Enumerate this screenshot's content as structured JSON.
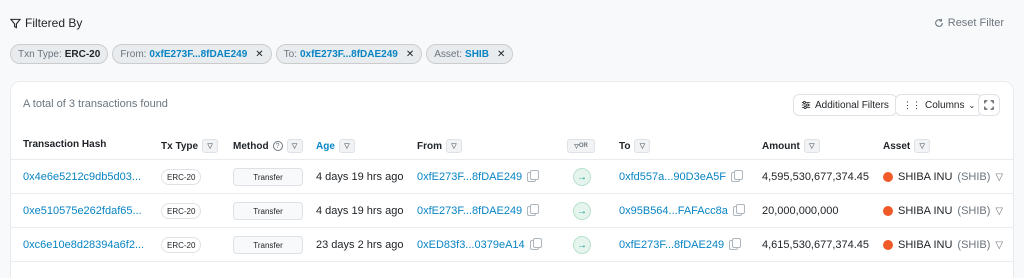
{
  "filter_bar": {
    "title": "Filtered By",
    "reset_label": "Reset Filter"
  },
  "chips": [
    {
      "label": "Txn Type:",
      "value": "ERC-20",
      "link": false,
      "closable": false
    },
    {
      "label": "From:",
      "value": "0xfE273F...8fDAE249",
      "link": true,
      "closable": true
    },
    {
      "label": "To:",
      "value": "0xfE273F...8fDAE249",
      "link": true,
      "closable": true
    },
    {
      "label": "Asset:",
      "value": "SHIB",
      "link": true,
      "closable": true
    }
  ],
  "card": {
    "summary": "A total of 3 transactions found",
    "additional_filters_label": "Additional Filters",
    "columns_label": "Columns"
  },
  "headers": {
    "hash": "Transaction Hash",
    "txtype": "Tx Type",
    "method": "Method",
    "age": "Age",
    "from": "From",
    "or": "OR",
    "to": "To",
    "amount": "Amount",
    "asset": "Asset"
  },
  "rows": [
    {
      "hash": "0x4e6e5212c9db5d03...",
      "txtype": "ERC-20",
      "method": "Transfer",
      "age": "4 days 19 hrs ago",
      "from": "0xfE273F...8fDAE249",
      "to": "0xfd557a...90D3eA5F",
      "amount": "4,595,530,677,374.45",
      "asset_name": "SHIBA INU",
      "asset_symbol": "(SHIB)"
    },
    {
      "hash": "0xe510575e262fdaf65...",
      "txtype": "ERC-20",
      "method": "Transfer",
      "age": "4 days 19 hrs ago",
      "from": "0xfE273F...8fDAE249",
      "to": "0x95B564...FAFAcc8a",
      "amount": "20,000,000,000",
      "asset_name": "SHIBA INU",
      "asset_symbol": "(SHIB)"
    },
    {
      "hash": "0xc6e10e8d28394a6f2...",
      "txtype": "ERC-20",
      "method": "Transfer",
      "age": "23 days 2 hrs ago",
      "from": "0xED83f3...0379eA14",
      "to": "0xfE273F...8fDAE249",
      "amount": "4,615,530,677,374.45",
      "asset_name": "SHIBA INU",
      "asset_symbol": "(SHIB)"
    }
  ]
}
